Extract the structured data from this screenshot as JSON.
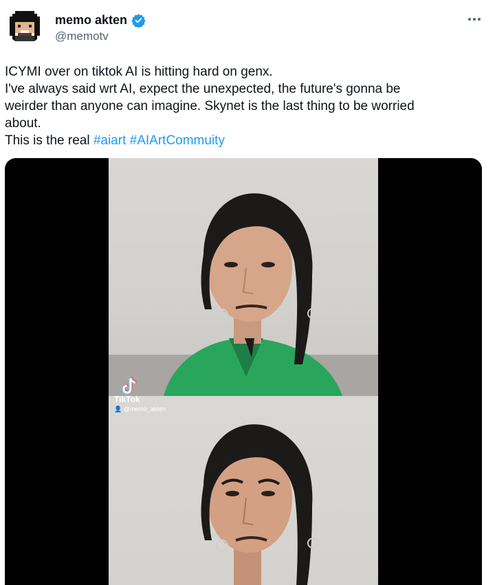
{
  "author": {
    "display_name": "memo akten",
    "handle": "@memotv",
    "verified_color": "#1d9bf0"
  },
  "tweet": {
    "lines": [
      "ICYMI over on tiktok AI is hitting hard on genx.",
      "I've always said wrt AI, expect the unexpected, the future's gonna be",
      "weirder than anyone can imagine. Skynet is the last thing to be worried",
      "about."
    ],
    "last_line_prefix": "This is the real ",
    "hashtags": [
      "#aiart",
      "#AIArtCommuity"
    ],
    "hashtag_color": "#1d9bf0"
  },
  "media": {
    "watermark_label": "TikTok",
    "watermark_user": "@memo_akten"
  },
  "icons": {
    "more": "more-horizontal-icon",
    "verified": "verified-badge-icon",
    "tiktok": "tiktok-logo-icon"
  }
}
